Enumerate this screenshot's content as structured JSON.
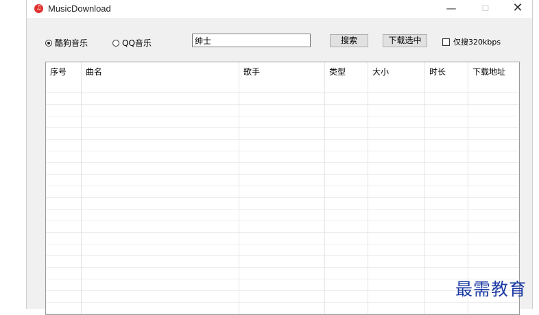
{
  "window": {
    "title": "MusicDownload",
    "min_glyph": "—",
    "max_glyph": "☐",
    "close_glyph": "✕"
  },
  "sources": {
    "kugou_label": "酷狗音乐",
    "qq_label": "QQ音乐",
    "selected": "kugou"
  },
  "search": {
    "value": "绅士",
    "search_label": "搜索",
    "download_selected_label": "下载选中",
    "only320_label": "仅搜320kbps",
    "only320_checked": false
  },
  "table": {
    "columns": [
      "序号",
      "曲名",
      "歌手",
      "类型",
      "大小",
      "时长",
      "下载地址"
    ],
    "rows": []
  },
  "watermark": "最需教育",
  "icons": {
    "app": "music-app-icon"
  }
}
